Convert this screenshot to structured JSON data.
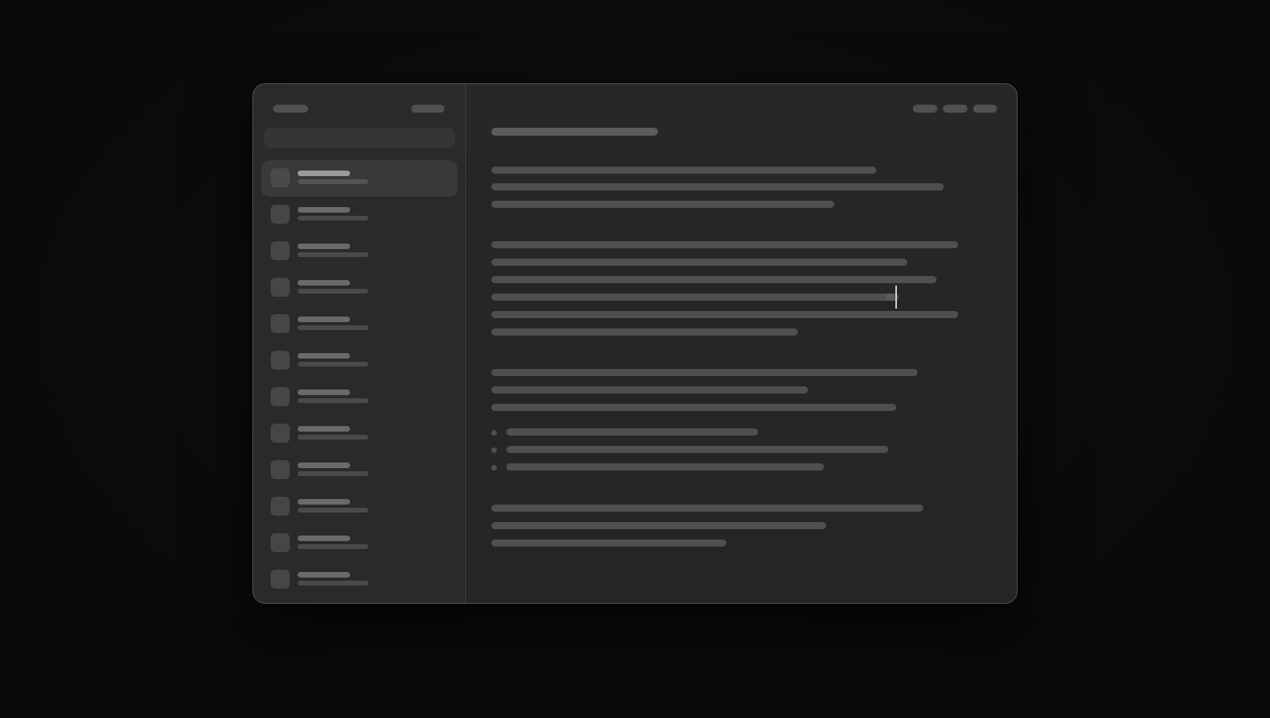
{
  "window": {
    "title": "",
    "sidebar": {
      "items": [
        {
          "title": "",
          "subtitle": "",
          "selected": true
        },
        {
          "title": "",
          "subtitle": "",
          "selected": false
        },
        {
          "title": "",
          "subtitle": "",
          "selected": false
        },
        {
          "title": "",
          "subtitle": "",
          "selected": false
        },
        {
          "title": "",
          "subtitle": "",
          "selected": false
        },
        {
          "title": "",
          "subtitle": "",
          "selected": false
        },
        {
          "title": "",
          "subtitle": "",
          "selected": false
        },
        {
          "title": "",
          "subtitle": "",
          "selected": false
        },
        {
          "title": "",
          "subtitle": "",
          "selected": false
        },
        {
          "title": "",
          "subtitle": "",
          "selected": false
        },
        {
          "title": "",
          "subtitle": "",
          "selected": false
        },
        {
          "title": "",
          "subtitle": "",
          "selected": false
        }
      ],
      "search_placeholder": ""
    },
    "editor": {
      "document_title": "",
      "paragraphs": 4,
      "bullets": 3
    }
  },
  "colors": {
    "background": "#0b0b0c",
    "window": "#262626",
    "sidebar": "#2a2a2a",
    "placeholder_bar": "#4f4f4f",
    "selected_item": "#393939",
    "cursor": "#d0d0d0"
  }
}
